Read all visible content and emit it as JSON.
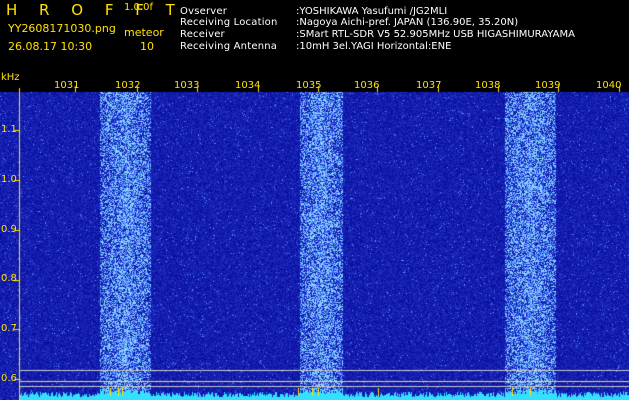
{
  "header": {
    "app_title": "H R O F F T",
    "app_version": "1.0.0f",
    "file_name": "YY2608171030.png",
    "mode_label": "meteor",
    "datetime": "26.08.17 10:30",
    "mode_value": "10"
  },
  "info": [
    {
      "key": "Ovserver",
      "value": ":YOSHIKAWA Yasufumi /JG2MLI"
    },
    {
      "key": "Receiving Location",
      "value": ":Nagoya Aichi-pref. JAPAN (136.90E, 35.20N)"
    },
    {
      "key": "Receiver",
      "value": ":SMart RTL-SDR V5 52.905MHz USB HIGASHIMURAYAMA"
    },
    {
      "key": "Receiving Antenna",
      "value": ":10mH 3el.YAGI Horizontal:ENE"
    }
  ],
  "waterfall": {
    "unit_label": "kHz",
    "y_ticks": [
      "1.1",
      "1.0",
      "0.9",
      "0.8",
      "0.7",
      "0.6"
    ],
    "y_values": [
      1.1,
      1.0,
      0.9,
      0.8,
      0.7,
      0.6
    ],
    "x_ticks": [
      "1031",
      "1032",
      "1033",
      "1034",
      "1035",
      "1036",
      "1037",
      "1038",
      "1039",
      "1040"
    ],
    "background_color": "#0a0a7a",
    "noise_color": "#3b5bff",
    "bright_color": "#7fe8ff",
    "baseline_color": "#33e0ff",
    "axis_color": "#ffe200",
    "bright_columns": [
      "1032",
      "1035",
      "1039"
    ]
  }
}
